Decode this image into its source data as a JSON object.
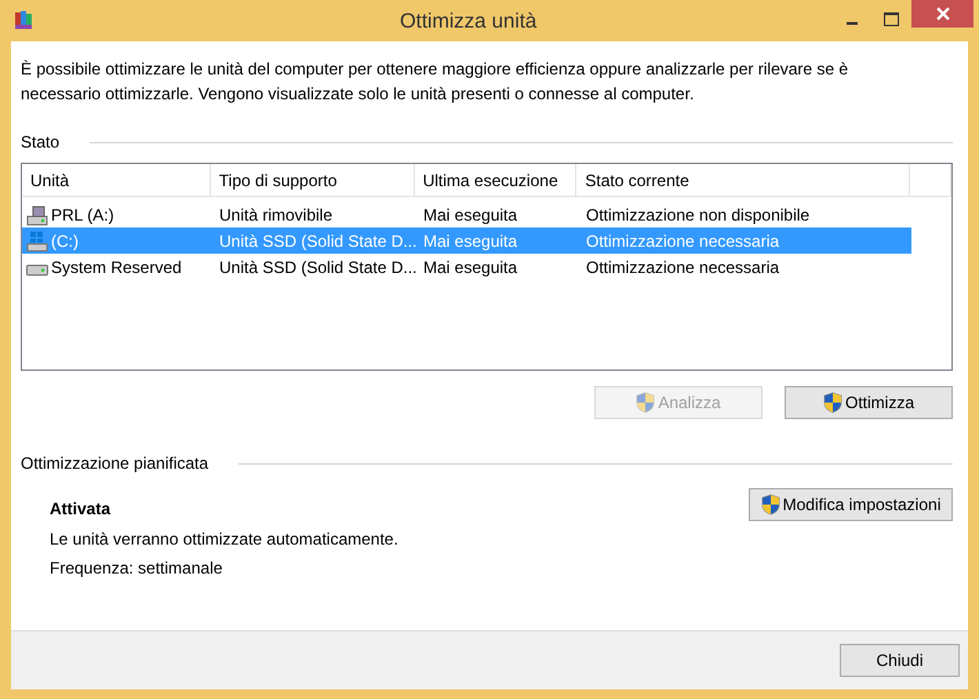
{
  "window": {
    "title": "Ottimizza unità"
  },
  "intro": "È possibile ottimizzare le unità del computer per ottenere maggiore efficienza oppure analizzarle per rilevare se è necessario ottimizzarle. Vengono visualizzate solo le unità presenti o connesse al computer.",
  "status_section": {
    "title": "Stato"
  },
  "table": {
    "columns": [
      "Unità",
      "Tipo di supporto",
      "Ultima esecuzione",
      "Stato corrente"
    ],
    "rows": [
      {
        "kind": "removable",
        "cells": [
          "PRL (A:)",
          "Unità rimovibile",
          "Mai eseguita",
          "Ottimizzazione non disponibile"
        ],
        "selected": false
      },
      {
        "kind": "system",
        "cells": [
          "(C:)",
          "Unità SSD (Solid State D...",
          "Mai eseguita",
          "Ottimizzazione necessaria"
        ],
        "selected": true
      },
      {
        "kind": "disk",
        "cells": [
          "System Reserved",
          "Unità SSD (Solid State D...",
          "Mai eseguita",
          "Ottimizzazione necessaria"
        ],
        "selected": false
      }
    ]
  },
  "actions": [
    {
      "label": "Analizza",
      "disabled": true
    },
    {
      "label": "Ottimizza",
      "disabled": false
    }
  ],
  "schedule": {
    "title": "Ottimizzazione pianificata",
    "state": "Attivata",
    "description": "Le unità verranno ottimizzate automaticamente.",
    "frequency": "Frequenza: settimanale",
    "button": "Modifica impostazioni"
  },
  "footer": {
    "close_button": "Chiudi"
  }
}
